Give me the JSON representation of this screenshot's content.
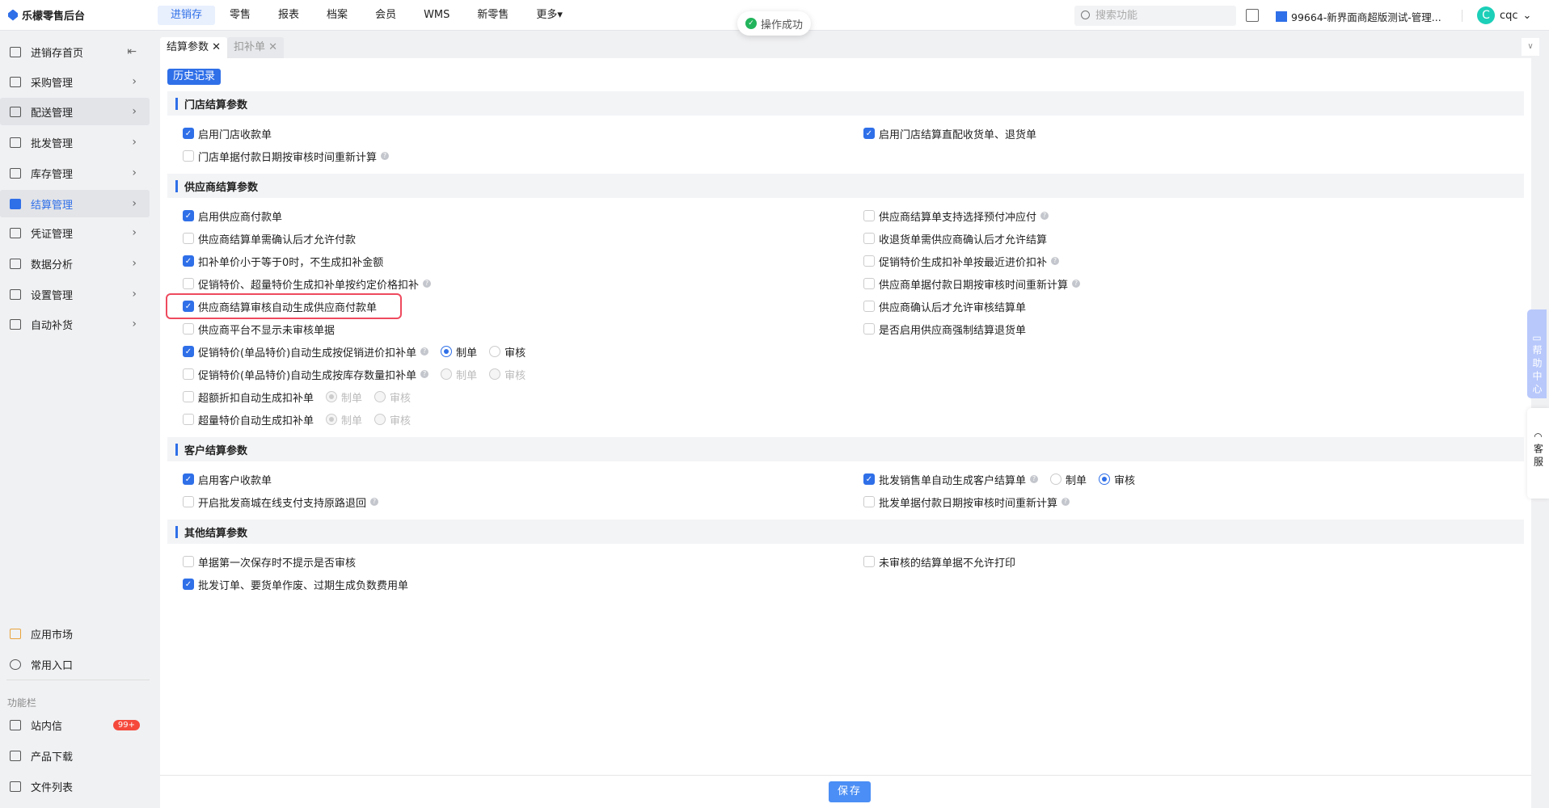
{
  "app": {
    "logo_text": "乐檬零售后台"
  },
  "nav": [
    "进销存",
    "零售",
    "报表",
    "档案",
    "会员",
    "WMS",
    "新零售",
    "更多▾"
  ],
  "toast": "操作成功",
  "search": {
    "placeholder": "搜索功能"
  },
  "store": "99664-新界面商超版测试-管理...",
  "user": {
    "avatar": "C",
    "name": "cqc"
  },
  "sidebar": {
    "items": [
      "进销存首页",
      "采购管理",
      "配送管理",
      "批发管理",
      "库存管理",
      "结算管理",
      "凭证管理",
      "数据分析",
      "设置管理",
      "自动补货"
    ],
    "bottom": [
      "应用市场",
      "常用入口"
    ],
    "section": "功能栏",
    "tools": [
      "站内信",
      "产品下载",
      "文件列表"
    ],
    "badge": "99+"
  },
  "tabs": [
    "结算参数",
    "扣补单"
  ],
  "history_button": "历史记录",
  "sections": [
    {
      "title": "门店结算参数",
      "rows": [
        [
          {
            "label": "启用门店收款单",
            "checked": true
          },
          {
            "label": "启用门店结算直配收货单、退货单",
            "checked": true
          }
        ],
        [
          {
            "label": "门店单据付款日期按审核时间重新计算",
            "checked": false,
            "help": true
          },
          null
        ]
      ]
    },
    {
      "title": "供应商结算参数",
      "rows": [
        [
          {
            "label": "启用供应商付款单",
            "checked": true
          },
          {
            "label": "供应商结算单支持选择预付冲应付",
            "checked": false,
            "help": true
          }
        ],
        [
          {
            "label": "供应商结算单需确认后才允许付款",
            "checked": false
          },
          {
            "label": "收退货单需供应商确认后才允许结算",
            "checked": false
          }
        ],
        [
          {
            "label": "扣补单价小于等于0时，不生成扣补金额",
            "checked": true
          },
          {
            "label": "促销特价生成扣补单按最近进价扣补",
            "checked": false,
            "help": true
          }
        ],
        [
          {
            "label": "促销特价、超量特价生成扣补单按约定价格扣补",
            "checked": false,
            "help": true
          },
          {
            "label": "供应商单据付款日期按审核时间重新计算",
            "checked": false,
            "help": true
          }
        ],
        [
          {
            "label": "供应商结算审核自动生成供应商付款单",
            "checked": true,
            "highlighted": true
          },
          {
            "label": "供应商确认后才允许审核结算单",
            "checked": false
          }
        ],
        [
          {
            "label": "供应商平台不显示未审核单据",
            "checked": false
          },
          {
            "label": "是否启用供应商强制结算退货单",
            "checked": false
          }
        ],
        [
          {
            "label": "促销特价(单品特价)自动生成按促销进价扣补单",
            "checked": true,
            "help": true,
            "radios": [
              {
                "label": "制单",
                "checked": true,
                "disabled": false
              },
              {
                "label": "审核",
                "checked": false,
                "disabled": false
              }
            ]
          },
          null
        ],
        [
          {
            "label": "促销特价(单品特价)自动生成按库存数量扣补单",
            "checked": false,
            "help": true,
            "radios": [
              {
                "label": "制单",
                "checked": false,
                "disabled": true
              },
              {
                "label": "审核",
                "checked": false,
                "disabled": true
              }
            ]
          },
          null
        ],
        [
          {
            "label": "超额折扣自动生成扣补单",
            "checked": false,
            "radios": [
              {
                "label": "制单",
                "checked": true,
                "disabled": true
              },
              {
                "label": "审核",
                "checked": false,
                "disabled": true
              }
            ]
          },
          null
        ],
        [
          {
            "label": "超量特价自动生成扣补单",
            "checked": false,
            "radios": [
              {
                "label": "制单",
                "checked": true,
                "disabled": true
              },
              {
                "label": "审核",
                "checked": false,
                "disabled": true
              }
            ]
          },
          null
        ]
      ]
    },
    {
      "title": "客户结算参数",
      "rows": [
        [
          {
            "label": "启用客户收款单",
            "checked": true
          },
          {
            "label": "批发销售单自动生成客户结算单",
            "checked": true,
            "help": true,
            "radios": [
              {
                "label": "制单",
                "checked": false,
                "disabled": false
              },
              {
                "label": "审核",
                "checked": true,
                "disabled": false
              }
            ]
          }
        ],
        [
          {
            "label": "开启批发商城在线支付支持原路退回",
            "checked": false,
            "help": true
          },
          {
            "label": "批发单据付款日期按审核时间重新计算",
            "checked": false,
            "help": true
          }
        ]
      ]
    },
    {
      "title": "其他结算参数",
      "rows": [
        [
          {
            "label": "单据第一次保存时不提示是否审核",
            "checked": false
          },
          {
            "label": "未审核的结算单据不允许打印",
            "checked": false
          }
        ],
        [
          {
            "label": "批发订单、要货单作废、过期生成负数费用单",
            "checked": true
          },
          null
        ]
      ]
    }
  ],
  "save_button": "保存",
  "float": {
    "help_center": "帮助中心",
    "service": "客服"
  },
  "colors": {
    "accent": "#2f6fe8",
    "highlight": "#ee4a5e",
    "success": "#22b45c"
  }
}
